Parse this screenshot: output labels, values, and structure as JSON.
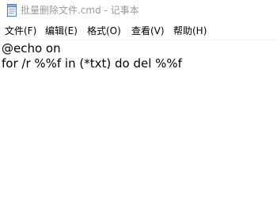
{
  "window": {
    "title": "批量删除文件.cmd - 记事本",
    "icon": "notepad-icon"
  },
  "menu": {
    "items": [
      {
        "label": "文件(F)"
      },
      {
        "label": "编辑(E)"
      },
      {
        "label": "格式(O)"
      },
      {
        "label": "查看(V)"
      },
      {
        "label": "帮助(H)"
      }
    ]
  },
  "editor": {
    "lines": [
      "@echo on",
      "for /r %%f in (*txt) do del %%f"
    ]
  },
  "colors": {
    "title_text": "#999999",
    "background": "#ffffff",
    "text": "#000000"
  }
}
